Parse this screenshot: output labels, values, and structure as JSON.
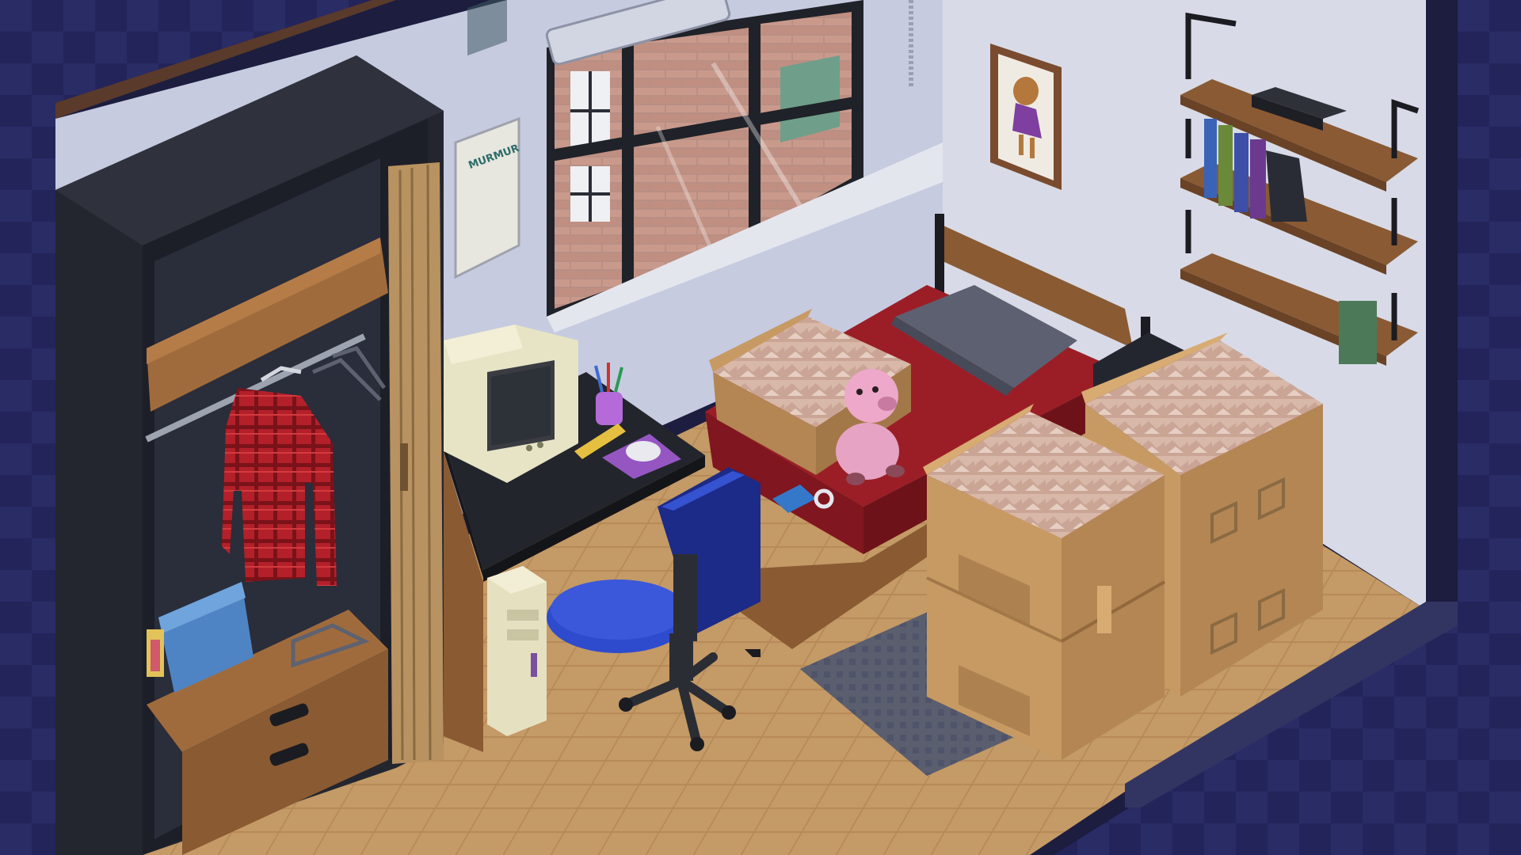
{
  "scene": {
    "poster_text": "MURMUR",
    "colors": {
      "background": "#23245a",
      "wall": "#d6d9e6",
      "floor": "#c49a66",
      "bed_sheet": "#9b1e27",
      "chair": "#2540b5",
      "box": "#c89a63",
      "bookcase": "#2a2d36"
    },
    "objects": [
      "closet",
      "red-plaid-shirt",
      "blue-bag",
      "wire-hangers",
      "folding-door",
      "window",
      "poster",
      "crt-monitor",
      "pencil-cup",
      "ruler",
      "mouse-pad",
      "computer-mouse",
      "pc-tower",
      "office-chair",
      "bed",
      "pillow",
      "pig-plush",
      "game-controller",
      "rug",
      "cardboard-boxes",
      "framed-art",
      "wall-shelves",
      "books",
      "nightstand"
    ]
  }
}
